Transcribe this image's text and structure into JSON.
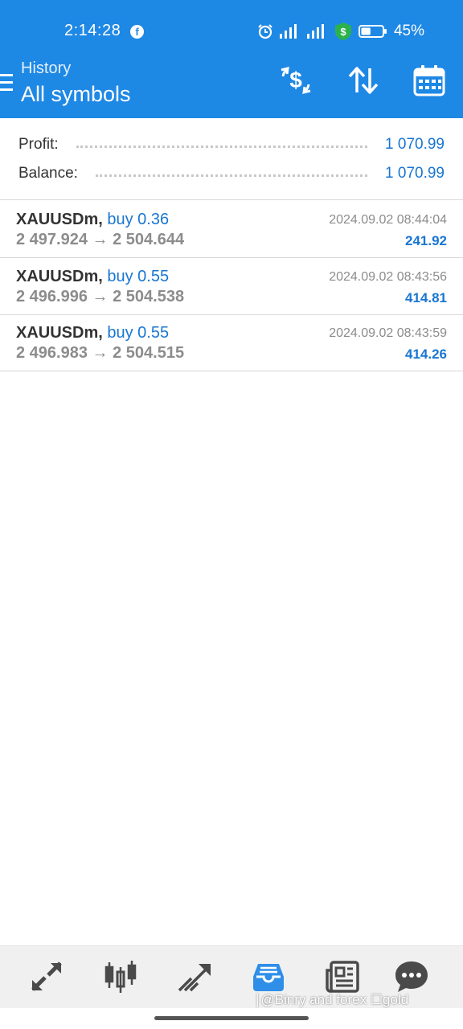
{
  "status_bar": {
    "time": "2:14:28",
    "battery_percent": "45%",
    "battery_level": 0.45
  },
  "header": {
    "subtitle": "History",
    "title": "All symbols",
    "icons": [
      "menu-icon",
      "dollar-refresh-icon",
      "sort-icon",
      "calendar-icon"
    ]
  },
  "summary": {
    "profit_label": "Profit:",
    "profit_value": "1 070.99",
    "balance_label": "Balance:",
    "balance_value": "1 070.99"
  },
  "deals": [
    {
      "symbol": "XAUUSDm,",
      "type": "buy 0.36",
      "prices": "2 497.924 → 2 504.644",
      "time": "2024.09.02 08:44:04",
      "profit": "241.92"
    },
    {
      "symbol": "XAUUSDm,",
      "type": "buy 0.55",
      "prices": "2 496.996 → 2 504.538",
      "time": "2024.09.02 08:43:56",
      "profit": "414.81"
    },
    {
      "symbol": "XAUUSDm,",
      "type": "buy 0.55",
      "prices": "2 496.983 → 2 504.515",
      "time": "2024.09.02 08:43:59",
      "profit": "414.26"
    }
  ],
  "bottom_nav": {
    "items": [
      "quotes-icon",
      "chart-icon",
      "trade-icon",
      "history-icon",
      "news-icon",
      "chat-icon"
    ],
    "active": "history-icon"
  },
  "watermark": "∣@Binry and forex ☐gold",
  "colors": {
    "primary": "#1e88e5",
    "accent_text": "#1976d2",
    "nav_active": "#2f8fe8",
    "nav_inactive": "#4a4a4a"
  }
}
